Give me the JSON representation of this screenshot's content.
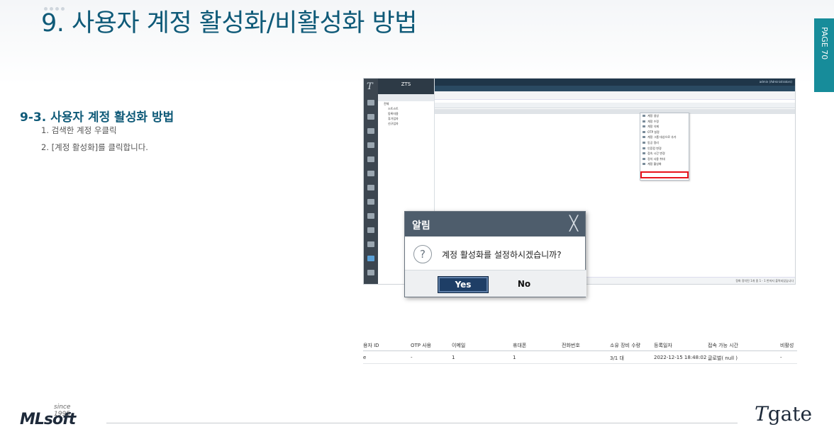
{
  "slide": {
    "title": "9.  사용자 계정 활성화/비활성화 방법",
    "page_label": "PAGE 70",
    "subheading": "9-3. 사용자 계정 활성화 방법",
    "steps": [
      "1.   검색한 계정 우클릭",
      "2.   [계정 활성화]를 클릭합니다."
    ]
  },
  "screenshot": {
    "rail_logo": "T",
    "tree_header": "ZTS",
    "tree_nodes": [
      "전체",
      "스트스트",
      "동록자용",
      "휴가업자",
      "신규업자"
    ],
    "admin_label": "admin (Administrators)",
    "status_text": "정화 정치된 1개 중 1 - 1 번까지 출력되었습니다",
    "context_menu": [
      "계정 생성",
      "계정 수정",
      "계정 삭제",
      "OTP 설정",
      "계정 그룹 대상으로 추가",
      "동공 정리",
      "인증킹 변경",
      "접속 시간 변경",
      "정치 사용 취대",
      "계정 활성화"
    ]
  },
  "dialog": {
    "title": "알림",
    "close_glyph": "╳",
    "icon_glyph": "?",
    "message": "계정 활성화를 설정하시겠습니까?",
    "yes_label": "Yes",
    "no_label": "No"
  },
  "table": {
    "headers": [
      "용자 ID",
      "OTP 사용",
      "이메일",
      "휴대폰",
      "전화번호",
      "소유 장비 수량",
      "등록일자",
      "접속 가능 시간",
      "비활성"
    ],
    "row": [
      "e",
      "-",
      "1",
      "1",
      "",
      "3/1 대",
      "2022-12-15 18:48:02",
      "글로벌( null )",
      "-"
    ]
  },
  "footer": {
    "brand_left": "MLsoft",
    "brand_since": "since 1995",
    "brand_right_initial": "T",
    "brand_right_rest": "gate"
  }
}
